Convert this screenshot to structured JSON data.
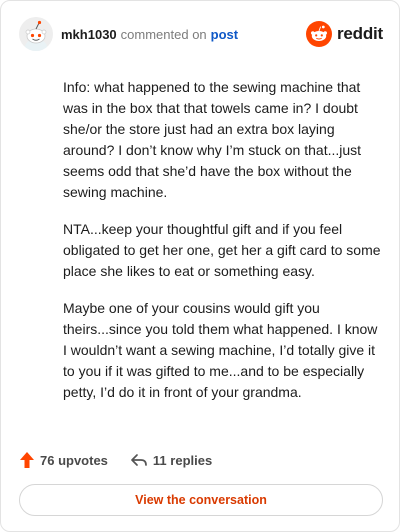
{
  "header": {
    "username": "mkh1030",
    "commented_on": "commented on",
    "post_link": "post",
    "brand": "reddit"
  },
  "comment": {
    "paragraphs": [
      "Info: what happened to the sewing machine that was in the box that that towels came in? I doubt she/or the store just had an extra box laying around? I don’t know why I’m stuck on that...just seems odd that she’d have the box without the sewing machine.",
      "NTA...keep your thoughtful gift and if you feel obligated to get her one, get her a gift card to some place she likes to eat or something easy.",
      "Maybe one of your cousins would gift you theirs...since you told them what happened. I know I wouldn’t want a sewing machine, I’d totally give it to you if it was gifted to me...and to be especially petty, I’d do it in front of your grandma."
    ]
  },
  "actions": {
    "upvotes": "76 upvotes",
    "replies": "11 replies"
  },
  "cta": {
    "label": "View the conversation"
  },
  "colors": {
    "accent": "#ff4500",
    "link": "#0e58c7",
    "cta_text": "#d93a00"
  },
  "icons": {
    "avatar": "snoo-avatar",
    "brand": "reddit-logo-icon",
    "upvote": "upvote-arrow-icon",
    "reply": "reply-arrow-icon"
  }
}
